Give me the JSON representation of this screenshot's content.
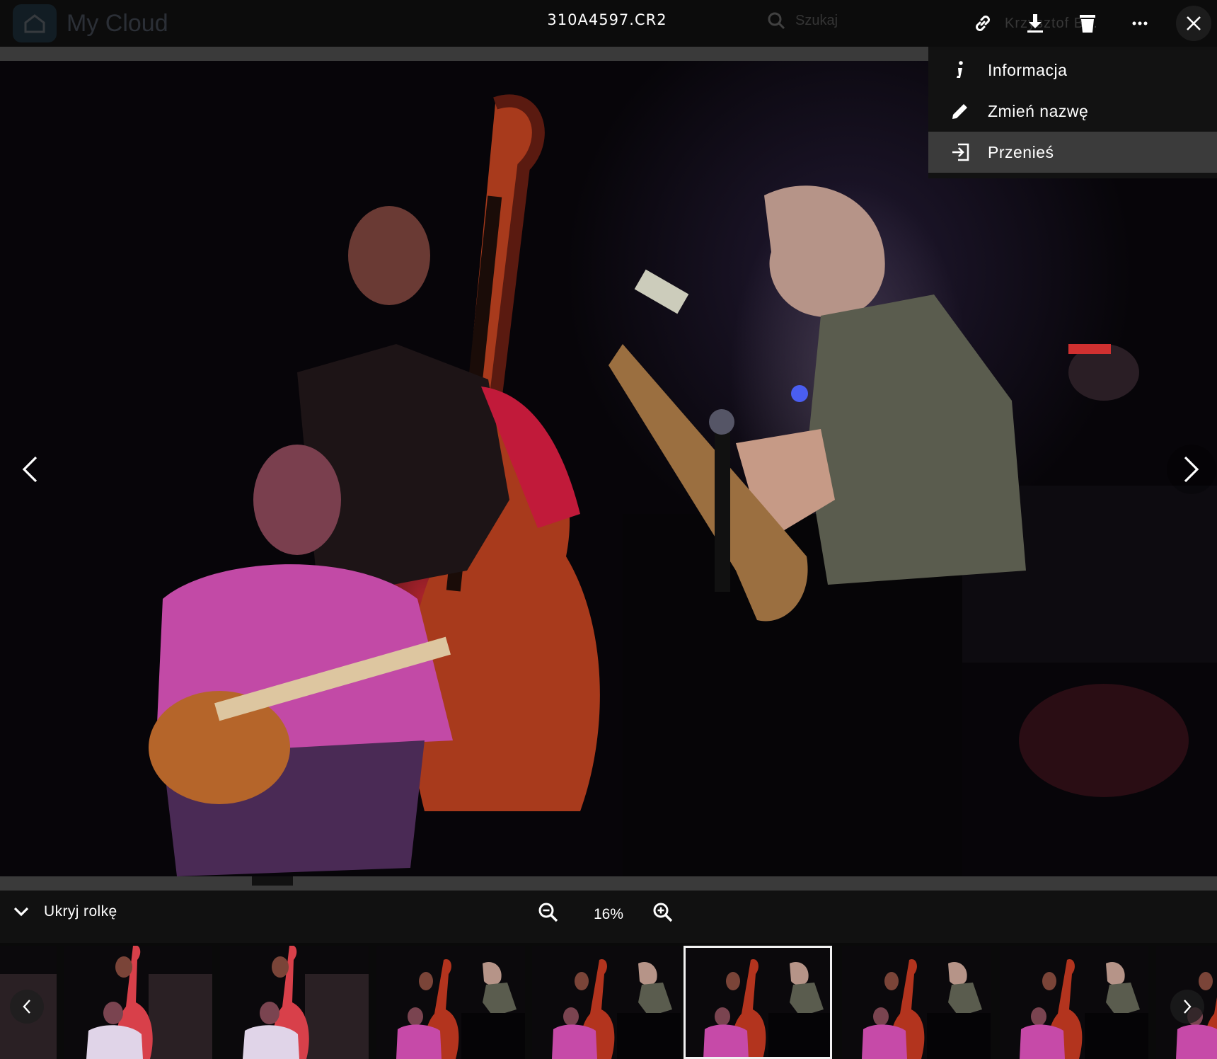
{
  "app": {
    "logo_text": "My Cloud",
    "search_placeholder": "Szukaj",
    "user_name": "Krzysztof B..."
  },
  "viewer": {
    "filename": "310A4597.CR2",
    "toolbar": {
      "link_icon": "link-icon",
      "download_icon": "download-icon",
      "delete_icon": "trash-icon",
      "more_icon": "more-icon",
      "close_icon": "close-icon"
    }
  },
  "menu": {
    "items": [
      {
        "label": "Informacja",
        "icon": "info-icon"
      },
      {
        "label": "Zmień nazwę",
        "icon": "pencil-icon"
      },
      {
        "label": "Przenieś",
        "icon": "move-icon"
      }
    ],
    "highlighted_index": 2
  },
  "bottom": {
    "hide_roll_label": "Ukryj rolkę",
    "zoom_value": "16%"
  },
  "filmstrip": {
    "thumbnail_count": 9,
    "selected_index": 5
  },
  "colors": {
    "background": "#111111",
    "menu_background": "#121212",
    "menu_highlight": "#3b3b3b",
    "text": "#ffffff"
  }
}
